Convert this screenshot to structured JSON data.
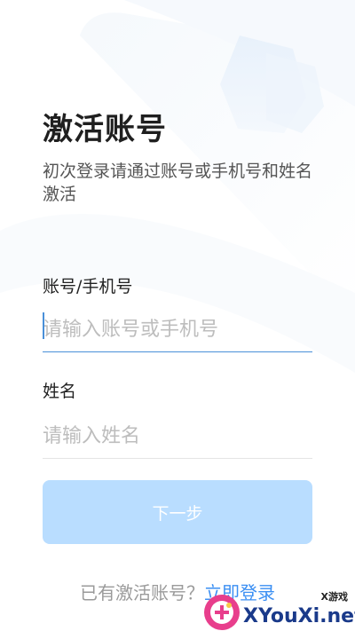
{
  "page": {
    "title": "激活账号",
    "subtitle": "初次登录请通过账号或手机号和姓名激活"
  },
  "account_field": {
    "label": "账号/手机号",
    "placeholder": "请输入账号或手机号",
    "value": ""
  },
  "name_field": {
    "label": "姓名",
    "placeholder": "请输入姓名",
    "value": ""
  },
  "next_button": {
    "label": "下一步"
  },
  "login_prompt": {
    "text": "已有激活账号？",
    "link": "立即登录"
  },
  "watermark": {
    "brand": "XYouXi.net",
    "sub": "X游戏"
  },
  "colors": {
    "accent": "#4a90d9",
    "button_disabled": "#b9ddff",
    "link": "#3b8ff3"
  }
}
